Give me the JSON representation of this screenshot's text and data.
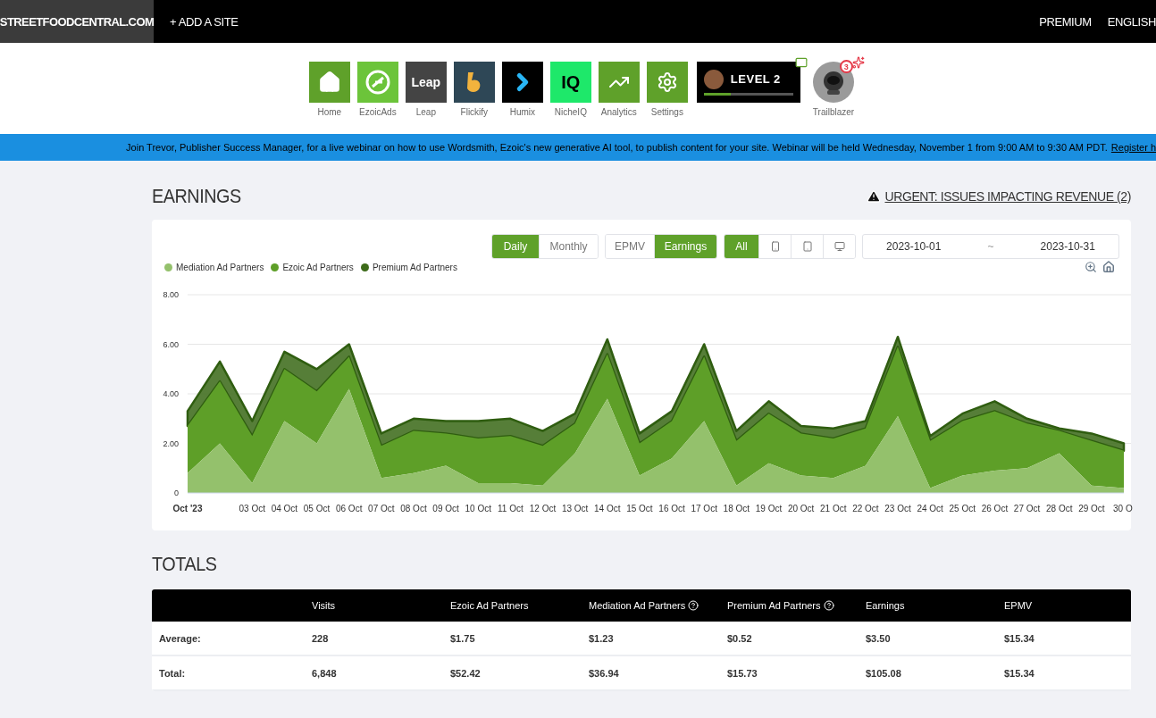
{
  "top_bar": {
    "site": "STREETFOODCENTRAL.COM",
    "add_site": "+ ADD A SITE",
    "links": [
      "PREMIUM",
      "ENGLISH"
    ]
  },
  "apps": [
    {
      "kind": "home",
      "label": "Home"
    },
    {
      "kind": "ezoicads",
      "label": "EzoicAds"
    },
    {
      "kind": "leap",
      "label": "Leap",
      "tile_text": "Leap"
    },
    {
      "kind": "flickify",
      "label": "Flickify"
    },
    {
      "kind": "humix",
      "label": "Humix"
    },
    {
      "kind": "nicheiq",
      "label": "NicheIQ",
      "tile_text": "IQ"
    },
    {
      "kind": "analytics",
      "label": "Analytics"
    },
    {
      "kind": "settings",
      "label": "Settings"
    }
  ],
  "level_card": {
    "label": "LEVEL 2",
    "level": 0.3
  },
  "trailblazer": {
    "label": "Trailblazer",
    "badge": "3"
  },
  "banner": {
    "text": "Join Trevor, Publisher Success Manager, for a live webinar on how to use Wordsmith, Ezoic's new generative AI tool, to publish content for your site. Webinar will be held Wednesday, November 1 from 9:00 AM to 9:30 AM PDT.",
    "link": "Register h"
  },
  "earnings": {
    "title": "EARNINGS",
    "alert": "URGENT: ISSUES IMPACTING REVENUE (2)",
    "period_tabs": [
      {
        "label": "Daily",
        "selected": true
      },
      {
        "label": "Monthly",
        "selected": false
      }
    ],
    "metric_tabs": [
      {
        "label": "EPMV",
        "selected": false
      },
      {
        "label": "Earnings",
        "selected": true
      }
    ],
    "device_tabs": [
      {
        "kind": "all",
        "label": "All",
        "selected": true
      },
      {
        "kind": "mobile",
        "selected": false
      },
      {
        "kind": "tablet",
        "selected": false
      },
      {
        "kind": "desktop",
        "selected": false
      }
    ],
    "date_from": "2023-10-01",
    "date_sep": "~",
    "date_to": "2023-10-31",
    "chart_data": {
      "type": "area",
      "stacked": true,
      "grid": true,
      "categories": [
        "Oct '23",
        null,
        "03 Oct",
        "04 Oct",
        "05 Oct",
        "06 Oct",
        "07 Oct",
        "08 Oct",
        "09 Oct",
        "10 Oct",
        "11 Oct",
        "12 Oct",
        "13 Oct",
        "14 Oct",
        "15 Oct",
        "16 Oct",
        "17 Oct",
        "18 Oct",
        "19 Oct",
        "20 Oct",
        "21 Oct",
        "22 Oct",
        "23 Oct",
        "24 Oct",
        "25 Oct",
        "26 Oct",
        "27 Oct",
        "28 Oct",
        "29 Oct",
        "30 O"
      ],
      "ylim": [
        0,
        8
      ],
      "yticks": [
        0,
        {
          "value": 2,
          "label": "2.00"
        },
        {
          "value": 4,
          "label": "4.00"
        },
        {
          "value": 6,
          "label": "6.00"
        },
        {
          "value": 8,
          "label": "8.00"
        }
      ],
      "series": [
        {
          "name": "Mediation Ad Partners",
          "color": "#94c16c",
          "values": [
            0.8,
            2.0,
            0.4,
            2.9,
            2.0,
            4.2,
            0.6,
            0.8,
            1.1,
            0.4,
            0.4,
            0.3,
            1.6,
            3.8,
            0.7,
            1.4,
            2.9,
            0.3,
            1.2,
            0.7,
            0.6,
            1.1,
            3.1,
            0.2,
            0.7,
            0.9,
            1.0,
            1.6,
            0.3,
            0.2
          ]
        },
        {
          "name": "Ezoic Ad Partners",
          "color": "#5e9f28",
          "values": [
            1.9,
            2.5,
            1.9,
            2.1,
            2.1,
            1.3,
            1.3,
            1.7,
            1.3,
            1.8,
            1.9,
            1.6,
            1.2,
            1.8,
            1.3,
            1.5,
            2.6,
            1.8,
            2.0,
            1.7,
            1.6,
            1.5,
            2.8,
            1.9,
            2.2,
            2.4,
            1.8,
            0.9,
            1.8,
            1.5
          ]
        },
        {
          "name": "Premium Ad Partners",
          "color": "#3d6b1a",
          "values": [
            0.6,
            0.8,
            0.6,
            0.7,
            0.9,
            0.5,
            0.5,
            0.5,
            0.5,
            0.7,
            0.7,
            0.6,
            0.4,
            0.6,
            0.4,
            0.4,
            0.5,
            0.4,
            0.5,
            0.3,
            0.4,
            0.3,
            0.4,
            0.2,
            0.3,
            0.4,
            0.2,
            0.1,
            0.3,
            0.3
          ]
        }
      ]
    }
  },
  "totals": {
    "title": "TOTALS",
    "columns": [
      {
        "label": "Visits",
        "help": false
      },
      {
        "label": "Ezoic Ad Partners",
        "help": false
      },
      {
        "label": "Mediation Ad Partners",
        "help": true
      },
      {
        "label": "Premium Ad Partners",
        "help": true
      },
      {
        "label": "Earnings",
        "help": false
      },
      {
        "label": "EPMV",
        "help": false
      }
    ],
    "rows": [
      {
        "label": "Average:",
        "cells": [
          "228",
          "$1.75",
          "$1.23",
          "$0.52",
          "$3.50",
          "$15.34"
        ]
      },
      {
        "label": "Total:",
        "cells": [
          "6,848",
          "$52.42",
          "$36.94",
          "$15.73",
          "$105.08",
          "$15.34"
        ]
      }
    ]
  }
}
